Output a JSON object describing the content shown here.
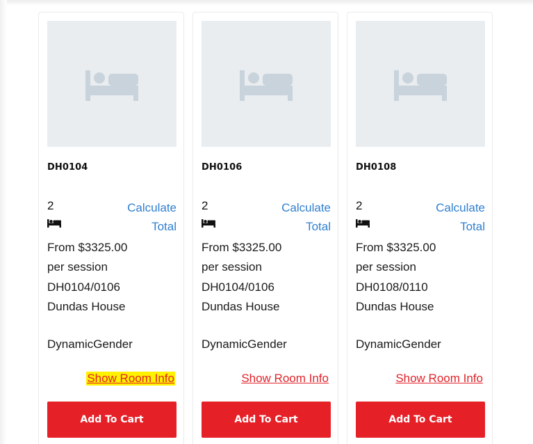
{
  "rooms": [
    {
      "code": "DH0104",
      "beds": "2",
      "calculate_label": "Calculate Total",
      "price": "From $3325.00",
      "period": "per session",
      "unit": "DH0104/0106",
      "building": "Dundas House",
      "gender": "DynamicGender",
      "info_label": "Show Room Info",
      "cart_label": "Add To Cart"
    },
    {
      "code": "DH0106",
      "beds": "2",
      "calculate_label": "Calculate Total",
      "price": "From $3325.00",
      "period": "per session",
      "unit": "DH0104/0106",
      "building": "Dundas House",
      "gender": "DynamicGender",
      "info_label": "Show Room Info",
      "cart_label": "Add To Cart"
    },
    {
      "code": "DH0108",
      "beds": "2",
      "calculate_label": "Calculate Total",
      "price": "From $3325.00",
      "period": "per session",
      "unit": "DH0108/0110",
      "building": "Dundas House",
      "gender": "DynamicGender",
      "info_label": "Show Room Info",
      "cart_label": "Add To Cart"
    }
  ],
  "colors": {
    "accent_red": "#e52027",
    "link_blue": "#2f7fd0",
    "highlight_yellow": "#fff200",
    "placeholder_bg": "#e9edf0"
  },
  "icons": {
    "placeholder": "bed-icon",
    "beds": "bed-icon"
  }
}
